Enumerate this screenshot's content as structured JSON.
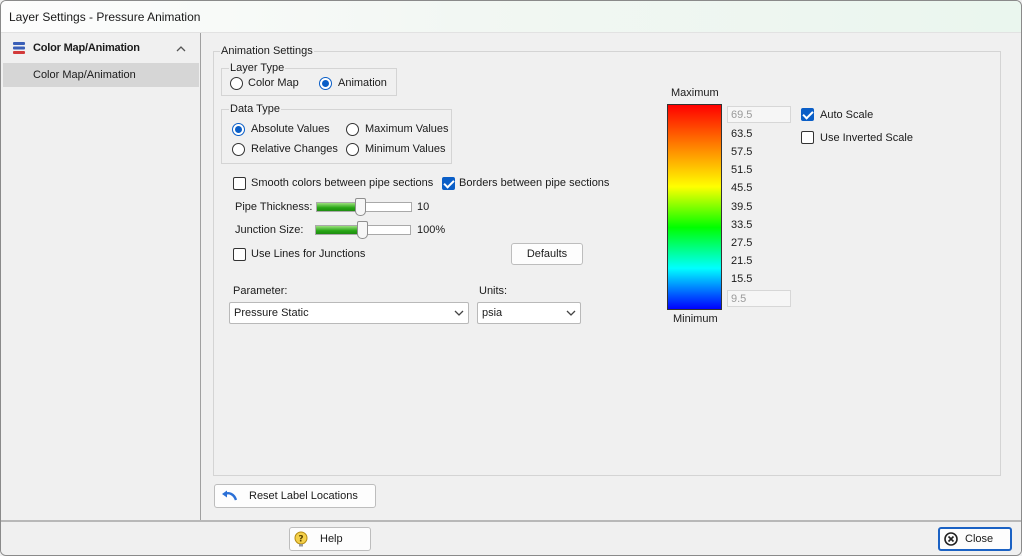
{
  "window": {
    "title": "Layer Settings - Pressure Animation"
  },
  "sidebar": {
    "header": {
      "label": "Color Map/Animation",
      "icon": "layers-icon",
      "toggle_icon": "chevron-up-icon"
    },
    "items": [
      {
        "label": "Color Map/Animation"
      }
    ]
  },
  "animation_settings": {
    "title": "Animation Settings",
    "layer_type": {
      "title": "Layer Type",
      "options": [
        {
          "label": "Color Map",
          "selected": false
        },
        {
          "label": "Animation",
          "selected": true
        }
      ]
    },
    "data_type": {
      "title": "Data Type",
      "options": [
        {
          "label": "Absolute Values",
          "selected": true
        },
        {
          "label": "Maximum Values",
          "selected": false
        },
        {
          "label": "Relative Changes",
          "selected": false
        },
        {
          "label": "Minimum Values",
          "selected": false
        }
      ]
    },
    "smooth_colors": {
      "label": "Smooth colors between pipe sections",
      "checked": false
    },
    "borders": {
      "label": "Borders between pipe sections",
      "checked": true
    },
    "pipe_thickness": {
      "label": "Pipe Thickness:",
      "value": "10",
      "fraction": 0.45
    },
    "junction_size": {
      "label": "Junction Size:",
      "value": "100%",
      "fraction": 0.5
    },
    "use_lines": {
      "label": "Use Lines for Junctions",
      "checked": false
    },
    "defaults_button": "Defaults",
    "parameter": {
      "label": "Parameter:",
      "value": "Pressure Static"
    },
    "units": {
      "label": "Units:",
      "value": "psia"
    }
  },
  "scale": {
    "max_label": "Maximum",
    "min_label": "Minimum",
    "max_value": "69.5",
    "min_value": "9.5",
    "ticks": [
      "63.5",
      "57.5",
      "51.5",
      "45.5",
      "39.5",
      "33.5",
      "27.5",
      "21.5",
      "15.5"
    ],
    "colors": [
      "#ff0000",
      "#ff8000",
      "#ffff00",
      "#00ff00",
      "#00ffff",
      "#0000ff"
    ]
  },
  "scale_options": {
    "auto_scale": {
      "label": "Auto Scale",
      "checked": true
    },
    "inverted": {
      "label": "Use Inverted Scale",
      "checked": false
    }
  },
  "reset_button": {
    "label": "Reset Label Locations",
    "icon": "undo-arrow-icon"
  },
  "footer": {
    "help": {
      "label": "Help",
      "icon": "help-icon"
    },
    "close": {
      "label": "Close",
      "icon": "close-circle-icon"
    }
  }
}
